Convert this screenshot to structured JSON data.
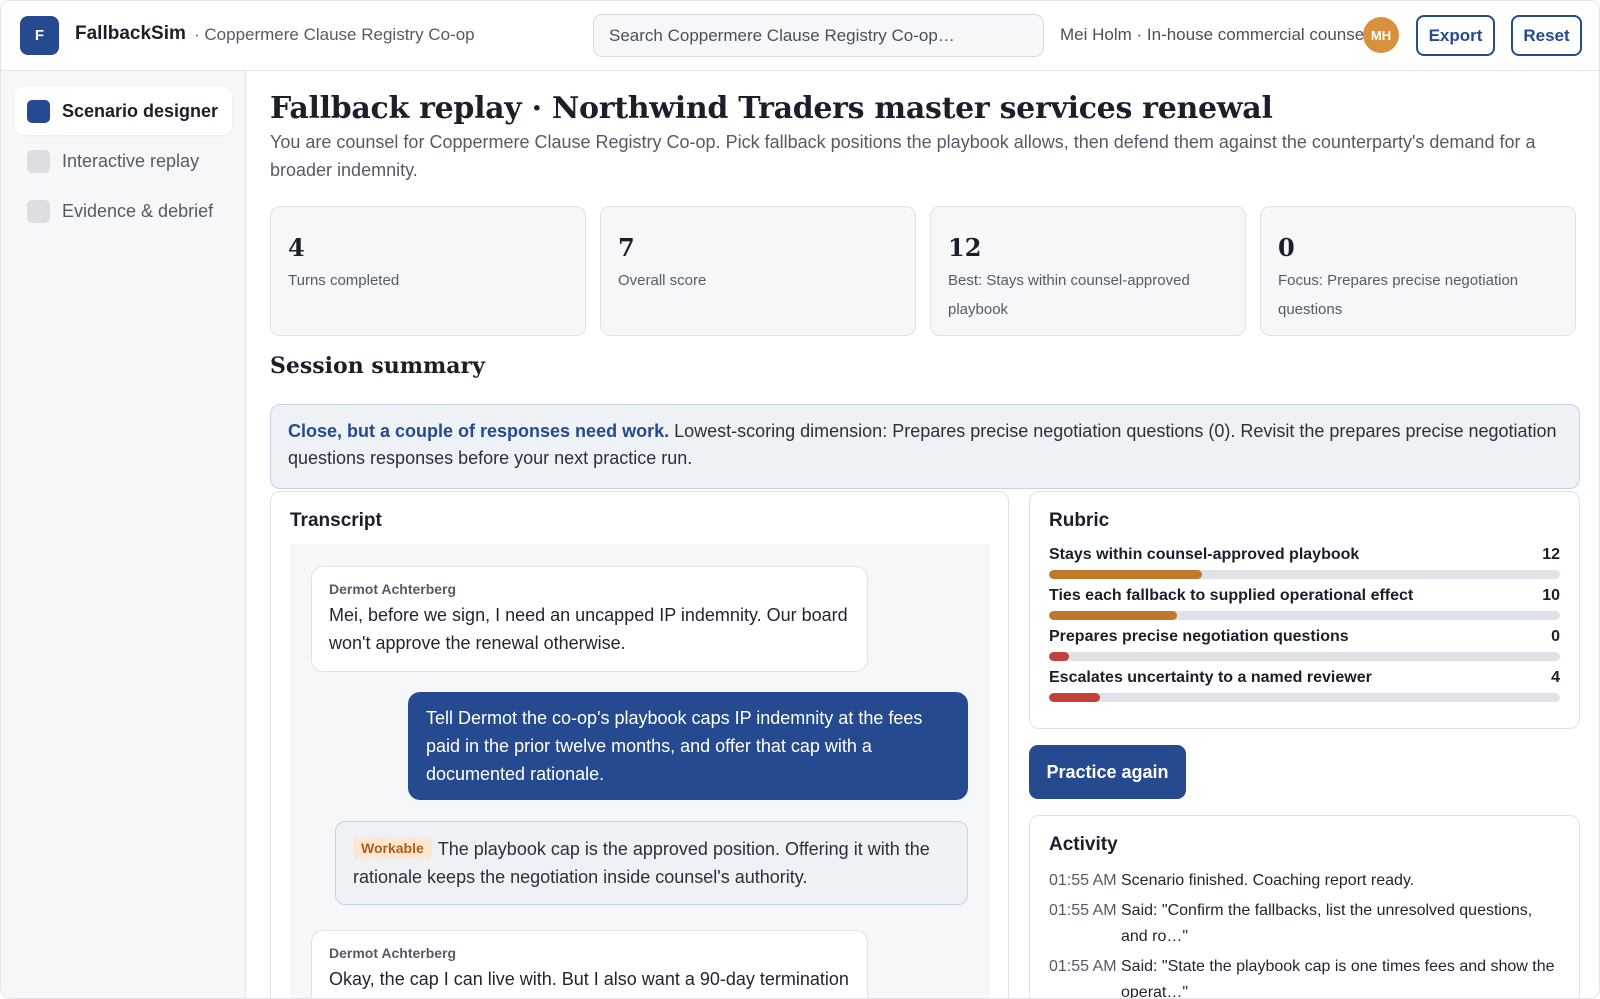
{
  "app": {
    "logo_letter": "F",
    "name": "FallbackSim",
    "org": "· Coppermere Clause Registry Co-op"
  },
  "search": {
    "placeholder": "Search Coppermere Clause Registry Co-op…"
  },
  "user": {
    "info": "Mei Holm · In-house commercial counsel",
    "initials": "MH"
  },
  "toolbar": {
    "export_label": "Export",
    "reset_label": "Reset"
  },
  "sidebar": {
    "items": [
      {
        "label": "Scenario designer",
        "active": true
      },
      {
        "label": "Interactive replay",
        "active": false
      },
      {
        "label": "Evidence & debrief",
        "active": false
      }
    ]
  },
  "page": {
    "title": "Fallback replay · Northwind Traders master services renewal",
    "subtitle": "You are counsel for Coppermere Clause Registry Co-op. Pick fallback positions the playbook allows, then defend them against the counterparty's demand for a broader indemnity."
  },
  "stats": [
    {
      "value": "4",
      "label": "Turns completed"
    },
    {
      "value": "7",
      "label": "Overall score"
    },
    {
      "value": "12",
      "label": "Best: Stays within counsel-approved playbook"
    },
    {
      "value": "0",
      "label": "Focus: Prepares precise negotiation questions"
    }
  ],
  "summary": {
    "title": "Session summary",
    "lead": "Close, but a couple of responses need work.",
    "body": " Lowest-scoring dimension: Prepares precise negotiation questions (0). Revisit the prepares precise negotiation questions responses before your next practice run."
  },
  "transcript": {
    "title": "Transcript",
    "messages": [
      {
        "author": "Dermot Achterberg",
        "text": "Mei, before we sign, I need an uncapped IP indemnity. Our board won't approve the renewal otherwise."
      },
      {
        "text": "Tell Dermot the co-op's playbook caps IP indemnity at the fees paid in the prior twelve months, and offer that cap with a documented rationale."
      },
      {
        "badge": "Workable",
        "text": "The playbook cap is the approved position. Offering it with the rationale keeps the negotiation inside counsel's authority."
      },
      {
        "author": "Dermot Achterberg",
        "text": "Okay, the cap I can live with. But I also want a 90-day termination"
      }
    ]
  },
  "rubric": {
    "title": "Rubric",
    "max": 20,
    "items": [
      {
        "label": "Stays within counsel-approved playbook",
        "value": "12",
        "fill": 0.3,
        "color": "#c0792a"
      },
      {
        "label": "Ties each fallback to supplied operational effect",
        "value": "10",
        "fill": 0.25,
        "color": "#c0792a"
      },
      {
        "label": "Prepares precise negotiation questions",
        "value": "0",
        "fill": 0.04,
        "color": "#c0413c"
      },
      {
        "label": "Escalates uncertainty to a named reviewer",
        "value": "4",
        "fill": 0.1,
        "color": "#c0413c"
      }
    ]
  },
  "practice_label": "Practice again",
  "activity": {
    "title": "Activity",
    "items": [
      {
        "time": "01:55 AM",
        "text": "Scenario finished. Coaching report ready."
      },
      {
        "time": "01:55 AM",
        "text": "Said: \"Confirm the fallbacks, list the unresolved questions, and ro…\""
      },
      {
        "time": "01:55 AM",
        "text": "Said: \"State the playbook cap is one times fees and show the operat…\""
      }
    ]
  }
}
